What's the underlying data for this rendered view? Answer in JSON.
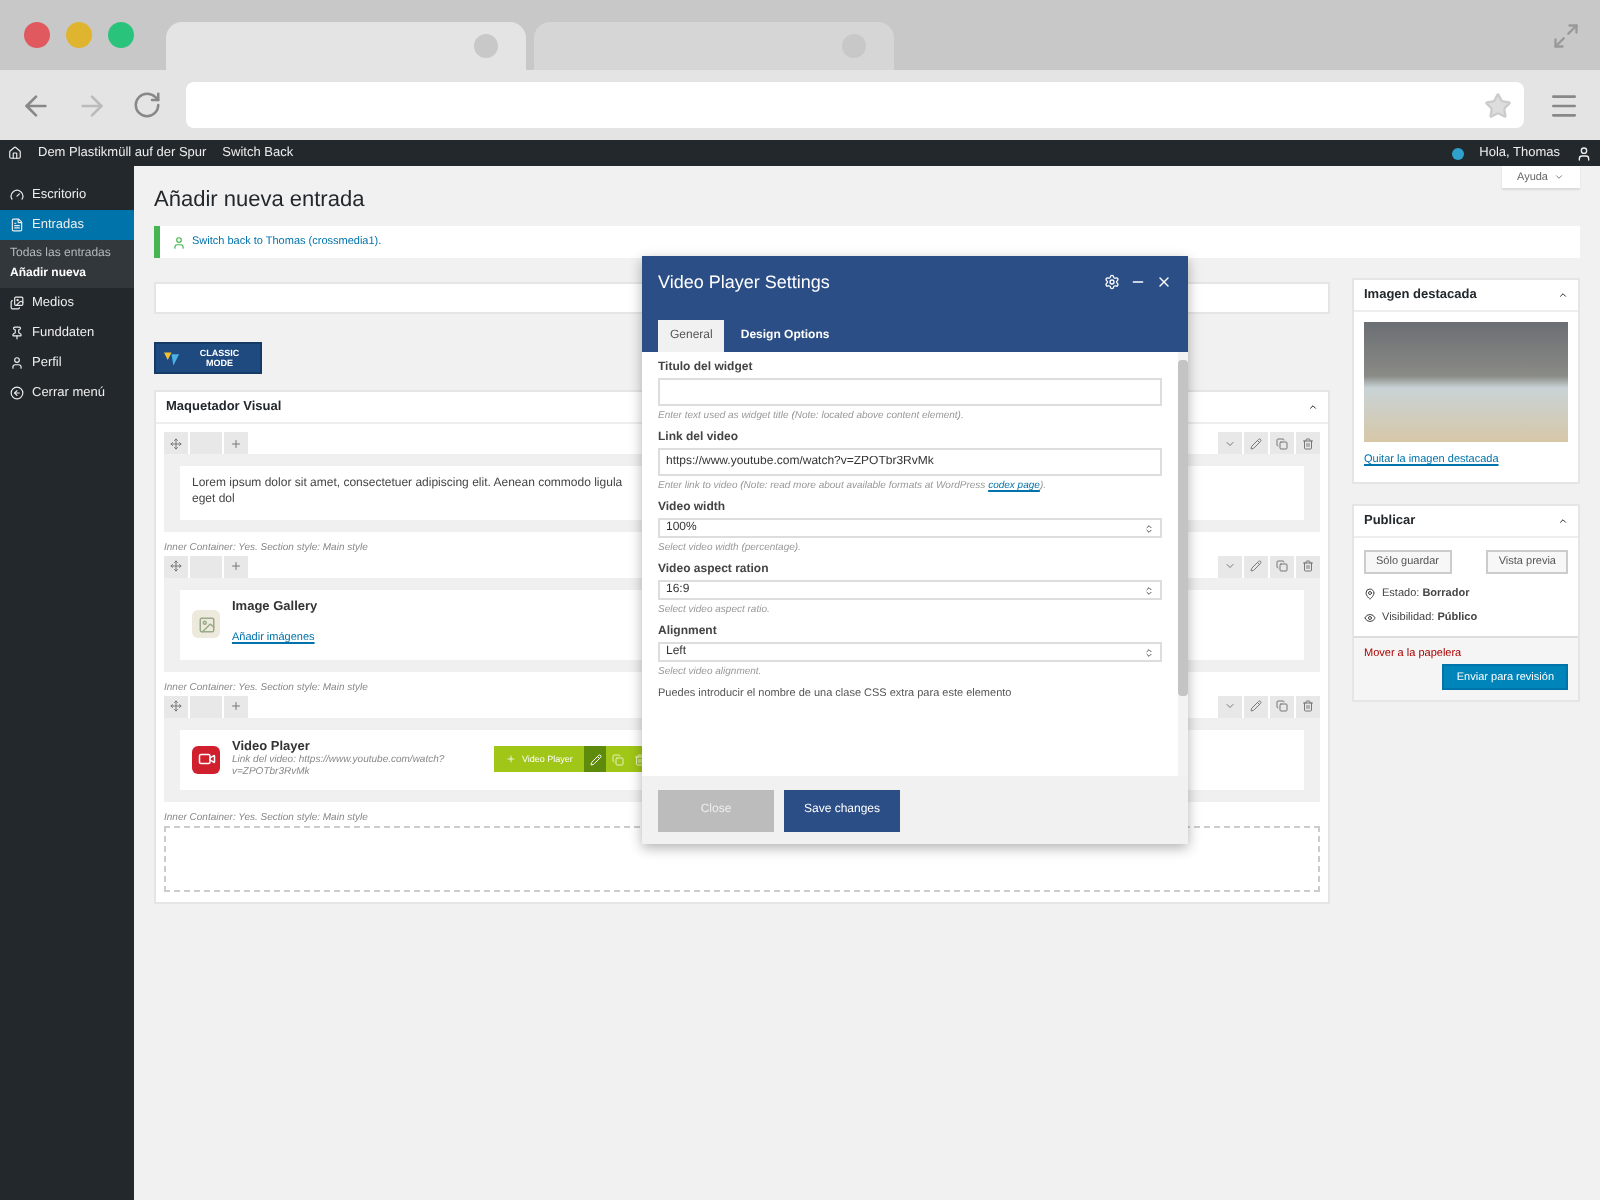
{
  "admin_bar": {
    "site": "Dem Plastikmüll auf der Spur",
    "switch": "Switch Back",
    "greeting": "Hola, Thomas"
  },
  "sidebar": {
    "items": [
      {
        "label": "Escritorio",
        "selected": false
      },
      {
        "label": "Entradas",
        "selected": true,
        "children": [
          {
            "label": "Todas las entradas",
            "selected": false
          },
          {
            "label": "Añadir nueva",
            "selected": true
          }
        ]
      },
      {
        "label": "Medios",
        "selected": false
      },
      {
        "label": "Funddaten",
        "selected": false
      },
      {
        "label": "Perfil",
        "selected": false
      },
      {
        "label": "Cerrar menú",
        "selected": false
      }
    ]
  },
  "help_tab": "Ayuda",
  "page_title": "Añadir nueva entrada",
  "notice": "Switch back to Thomas (crossmedia1).",
  "classic_mode_button": "CLASSIC MODE",
  "builder": {
    "title": "Maquetador Visual",
    "rows": [
      {
        "kind": "text",
        "text": "Lorem ipsum dolor sit amet, consectetuer adipiscing elit. Aenean commodo ligula eget dol"
      },
      {
        "kind": "gallery",
        "caption": "Inner Container: Yes. Section style: Main style",
        "title": "Image Gallery",
        "link": "Añadir imágenes"
      },
      {
        "kind": "video",
        "caption": "Inner Container: Yes. Section style: Main style",
        "title": "Video Player",
        "subtitle": "Link del video: https://www.youtube.com/watch?v=ZPOTbr3RvMk",
        "hover_label": "Video Player"
      },
      {
        "kind": "empty",
        "caption": "Inner Container: Yes. Section style: Main style"
      }
    ]
  },
  "featured_image": {
    "title": "Imagen destacada",
    "remove_link": "Quitar la imagen destacada"
  },
  "publish": {
    "title": "Publicar",
    "save_draft": "Sólo guardar",
    "preview": "Vista previa",
    "status_label": "Estado:",
    "status": "Borrador",
    "visibility_label": "Visibilidad:",
    "visibility": "Público",
    "trash": "Mover a la papelera",
    "submit": "Enviar para revisión"
  },
  "modal": {
    "title": "Video Player Settings",
    "tabs": [
      {
        "label": "General",
        "selected": true
      },
      {
        "label": "Design Options",
        "selected": false
      }
    ],
    "fields": [
      {
        "kind": "text",
        "label": "Titulo del widget",
        "help": "Enter text used as widget title (Note: located above content element)."
      },
      {
        "kind": "text",
        "label": "Link del video",
        "value": "https://www.youtube.com/watch?v=ZPOTbr3RvMk",
        "help": "Enter link to video (Note: read more about available formats at WordPress ",
        "help_link": "codex page",
        "help_after": ")."
      },
      {
        "kind": "select",
        "label": "Video width",
        "value": "100%",
        "help": "Select video width (percentage)."
      },
      {
        "kind": "select",
        "label": "Video aspect ration",
        "value": "16:9",
        "help": "Select video aspect ratio."
      },
      {
        "kind": "select",
        "label": "Alignment",
        "value": "Left",
        "help": "Select video alignment."
      }
    ],
    "note": "Puedes introducir el nombre de una clase CSS extra para este elemento",
    "close_button": "Close",
    "save_button": "Save changes"
  }
}
